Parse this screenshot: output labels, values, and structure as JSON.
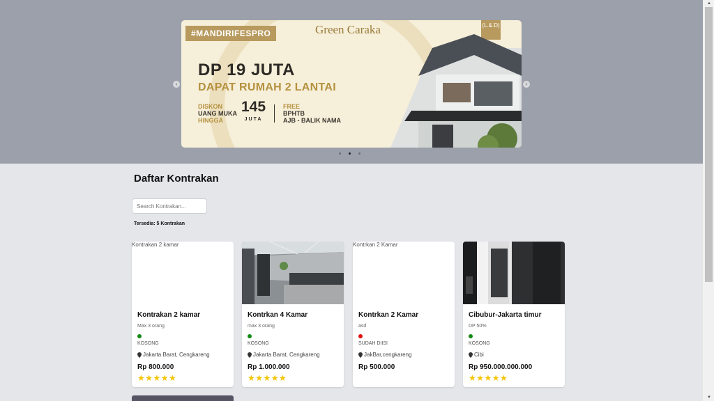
{
  "banner": {
    "tag": "#MANDIRIFESPRO",
    "brand": "Green Caraka",
    "headline": "DP 19 JUTA",
    "subline": "DAPAT RUMAH 2 LANTAI",
    "discount_label_1": "DISKON",
    "discount_label_2": "UANG MUKA",
    "discount_label_3": "HINGGA",
    "discount_value": "145",
    "discount_unit": "JUTA",
    "free_1": "FREE",
    "free_2": "BPHTB",
    "free_3": "AJB - BALIK NAMA"
  },
  "carousel": {
    "slides": 3,
    "active": 2
  },
  "page": {
    "title": "Daftar Kontrakan",
    "search_placeholder": "Search Kontrakan...",
    "available": "Tersedia: 5 Kontrakan"
  },
  "cards": [
    {
      "alt": "Kontrakan 2 kamar",
      "name": "Kontrakan 2 kamar",
      "desc": "Max 3 orang",
      "status": "KOSONG",
      "status_color": "#138a13",
      "location": "Jakarta Barat, Cengkareng",
      "price": "Rp 800.000",
      "stars": "★★★★★",
      "image": "none"
    },
    {
      "alt": "",
      "name": "Kontrkan 4 Kamar",
      "desc": "max 3 orang",
      "status": "KOSONG",
      "status_color": "#138a13",
      "location": "Jakarta Barat, Cengkareng",
      "price": "Rp 1.000.000",
      "stars": "★★★★★",
      "image": "corridor"
    },
    {
      "alt": "Kontrkan 2 Kamar",
      "name": "Kontrkan 2 Kamar",
      "desc": "asd",
      "status": "SUDAH DIISI",
      "status_color": "#e01010",
      "location": "JakBar,cengkareng",
      "price": "Rp 500.000",
      "stars": "",
      "image": "none"
    },
    {
      "alt": "",
      "name": "Cibubur-Jakarta timur",
      "desc": "DP 50%",
      "status": "KOSONG",
      "status_color": "#138a13",
      "location": "Cibi",
      "price": "Rp 950.000.000.000",
      "stars": "★★★★★",
      "image": "door"
    }
  ]
}
